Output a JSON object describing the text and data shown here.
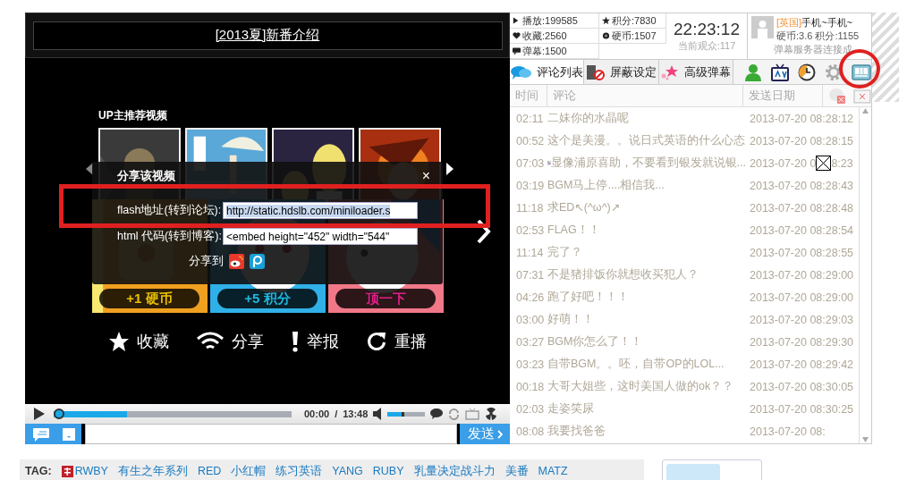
{
  "title_bar": {
    "title": "[2013夏]新番介绍"
  },
  "recommend": {
    "heading": "UP主推荐视频"
  },
  "lower_panels": [
    {
      "kind": "picture",
      "button": {
        "label": "+1 硬币"
      }
    },
    {
      "kind": "picture",
      "button": {
        "label": "+5 积分"
      }
    },
    {
      "kind": "picture",
      "button": {
        "label": "顶一下"
      }
    }
  ],
  "share_dialog": {
    "title": "分享该视频",
    "close": "×",
    "fields": [
      {
        "label": "flash地址(转到论坛):",
        "value": "http://static.hdslb.com/miniloader.s",
        "selected": true
      },
      {
        "label": "html 代码(转到博客):",
        "value": "<embed height=\"452\" width=\"544\"",
        "selected": false
      }
    ],
    "share_label": "分享到",
    "share_targets": [
      {
        "kind": "weibo"
      },
      {
        "kind": "tencent"
      }
    ]
  },
  "actions": [
    {
      "label": "收藏",
      "kind": "star"
    },
    {
      "label": "分享",
      "kind": "wifi"
    },
    {
      "label": "举报",
      "kind": "alert"
    },
    {
      "label": "重播",
      "kind": "replay"
    }
  ],
  "controls": {
    "elapsed": "00:00",
    "separator": "/",
    "duration": "13:48",
    "progress": {
      "level": 0.31
    },
    "volume": {
      "level": 0.45
    }
  },
  "comment_input": {
    "send": "发送"
  },
  "stats": [
    {
      "kind": "play",
      "text": "播放:199585"
    },
    {
      "kind": "score",
      "text": "积分:7830"
    },
    {
      "kind": "fav",
      "text": "收藏:2560"
    },
    {
      "kind": "coin",
      "text": "硬币:1507"
    },
    {
      "kind": "danmaku",
      "text": "弹幕:1500"
    }
  ],
  "clock": {
    "time": "22:23:12",
    "viewers": "当前观众:117"
  },
  "user": {
    "region": "[英国]",
    "name": "手机~手机~",
    "coins": "硬币:3.6 积分:1155",
    "status": "弹幕服务器连接成"
  },
  "tabs": [
    {
      "label": "评论列表",
      "kind": "bubbles",
      "selected": true
    },
    {
      "label": "屏蔽设定",
      "kind": "block",
      "selected": false
    },
    {
      "label": "高级弹幕",
      "kind": "stars",
      "selected": false
    }
  ],
  "toolbar": [
    {
      "kind": "person"
    },
    {
      "kind": "tv"
    },
    {
      "kind": "clock"
    },
    {
      "kind": "gear"
    },
    {
      "kind": "screen"
    }
  ],
  "comments": {
    "columns": [
      "时间",
      "评论",
      "发送日期"
    ],
    "rows": [
      {
        "kind": "plain",
        "time": "02:11",
        "text": "二妹你的水晶呢",
        "date": "2013-07-20 08:28:12"
      },
      {
        "kind": "plain",
        "time": "00:52",
        "text": "这个是美漫。。说日式英语的什么心态",
        "date": "2013-07-20 08:28:15"
      },
      {
        "kind": "broken",
        "time": "07:03",
        "text": "显像浦原喜助，不要看到银发就说银...",
        "date": "2013-07-20 0",
        "date_tail": "8:23"
      },
      {
        "kind": "plain",
        "time": "03:19",
        "text": "BGM马上停....相信我...",
        "date": "2013-07-20 08:28:43"
      },
      {
        "kind": "plain",
        "time": "11:18",
        "text": "求ED↖(^ω^)↗",
        "date": "2013-07-20 08:28:48"
      },
      {
        "kind": "plain",
        "time": "02:53",
        "text": "FLAG！！",
        "date": "2013-07-20 08:28:54"
      },
      {
        "kind": "plain",
        "time": "11:14",
        "text": "完了？",
        "date": "2013-07-20 08:28:55"
      },
      {
        "kind": "plain",
        "time": "07:31",
        "text": "不是猪排饭你就想收买犯人？",
        "date": "2013-07-20 08:29:00"
      },
      {
        "kind": "plain",
        "time": "04:26",
        "text": "跑了好吧！！！",
        "date": "2013-07-20 08:29:00"
      },
      {
        "kind": "plain",
        "time": "03:00",
        "text": "好萌！！",
        "date": "2013-07-20 08:29:03"
      },
      {
        "kind": "plain",
        "time": "03:27",
        "text": "BGM你怎么了！！",
        "date": "2013-07-20 08:29:30"
      },
      {
        "kind": "plain",
        "time": "03:23",
        "text": "自带BGM。。呸，自带OP的LOL...",
        "date": "2013-07-20 08:29:42"
      },
      {
        "kind": "plain",
        "time": "00:18",
        "text": "大哥大姐些，这时美国人做的ok？？",
        "date": "2013-07-20 08:30:05"
      },
      {
        "kind": "plain",
        "time": "02:03",
        "text": "走姿笑尿",
        "date": "2013-07-20 08:30:25"
      },
      {
        "kind": "plain",
        "time": "08:08",
        "text": "我要找爸爸",
        "date": "2013-07-20 08:"
      }
    ]
  },
  "tags": {
    "label": "TAG:",
    "items": [
      "RWBY",
      "有生之年系列",
      "RED",
      "小红帽",
      "练习英语",
      "YANG",
      "RUBY",
      "乳量决定战斗力",
      "美番",
      "MATZ"
    ]
  }
}
